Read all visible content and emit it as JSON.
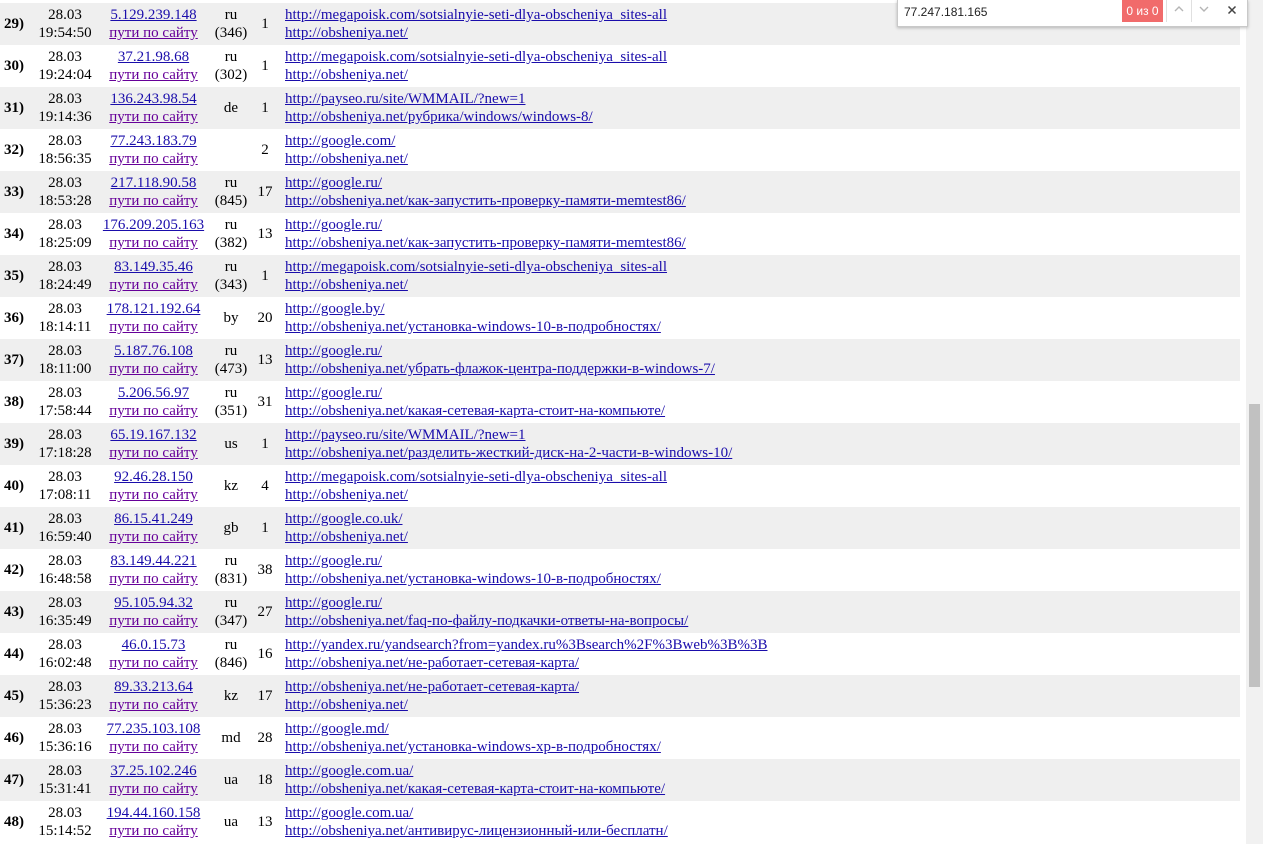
{
  "rows": [
    {
      "num": "29)",
      "date": "28.03",
      "time": "19:54:50",
      "ip": "5.129.239.148",
      "paths": "пути по сайту",
      "cc": "ru",
      "cc2": "(346)",
      "hits": "1",
      "ref1": "http://megapoisk.com/sotsialnyie-seti-dlya-obscheniya_sites-all",
      "ref2": "http://obsheniya.net/"
    },
    {
      "num": "30)",
      "date": "28.03",
      "time": "19:24:04",
      "ip": "37.21.98.68",
      "paths": "пути по сайту",
      "cc": "ru",
      "cc2": "(302)",
      "hits": "1",
      "ref1": "http://megapoisk.com/sotsialnyie-seti-dlya-obscheniya_sites-all",
      "ref2": "http://obsheniya.net/"
    },
    {
      "num": "31)",
      "date": "28.03",
      "time": "19:14:36",
      "ip": "136.243.98.54",
      "paths": "пути по сайту",
      "cc": "de",
      "cc2": "",
      "hits": "1",
      "ref1": "http://payseo.ru/site/WMMAIL/?new=1",
      "ref2": "http://obsheniya.net/рубрика/windows/windows-8/"
    },
    {
      "num": "32)",
      "date": "28.03",
      "time": "18:56:35",
      "ip": "77.243.183.79",
      "paths": "пути по сайту",
      "cc": "",
      "cc2": "",
      "hits": "2",
      "ref1": "http://google.com/",
      "ref2": "http://obsheniya.net/"
    },
    {
      "num": "33)",
      "date": "28.03",
      "time": "18:53:28",
      "ip": "217.118.90.58",
      "paths": "пути по сайту",
      "cc": "ru",
      "cc2": "(845)",
      "hits": "17",
      "ref1": "http://google.ru/",
      "ref2": "http://obsheniya.net/как-запустить-проверку-памяти-memtest86/"
    },
    {
      "num": "34)",
      "date": "28.03",
      "time": "18:25:09",
      "ip": "176.209.205.163",
      "paths": "пути по сайту",
      "cc": "ru",
      "cc2": "(382)",
      "hits": "13",
      "ref1": "http://google.ru/",
      "ref2": "http://obsheniya.net/как-запустить-проверку-памяти-memtest86/"
    },
    {
      "num": "35)",
      "date": "28.03",
      "time": "18:24:49",
      "ip": "83.149.35.46",
      "paths": "пути по сайту",
      "cc": "ru",
      "cc2": "(343)",
      "hits": "1",
      "ref1": "http://megapoisk.com/sotsialnyie-seti-dlya-obscheniya_sites-all",
      "ref2": "http://obsheniya.net/"
    },
    {
      "num": "36)",
      "date": "28.03",
      "time": "18:14:11",
      "ip": "178.121.192.64",
      "paths": "пути по сайту",
      "cc": "by",
      "cc2": "",
      "hits": "20",
      "ref1": "http://google.by/",
      "ref2": "http://obsheniya.net/установка-windows-10-в-подробностях/"
    },
    {
      "num": "37)",
      "date": "28.03",
      "time": "18:11:00",
      "ip": "5.187.76.108",
      "paths": "пути по сайту",
      "cc": "ru",
      "cc2": "(473)",
      "hits": "13",
      "ref1": "http://google.ru/",
      "ref2": "http://obsheniya.net/убрать-флажок-центра-поддержки-в-windows-7/"
    },
    {
      "num": "38)",
      "date": "28.03",
      "time": "17:58:44",
      "ip": "5.206.56.97",
      "paths": "пути по сайту",
      "cc": "ru",
      "cc2": "(351)",
      "hits": "31",
      "ref1": "http://google.ru/",
      "ref2": "http://obsheniya.net/какая-сетевая-карта-стоит-на-компьюте/"
    },
    {
      "num": "39)",
      "date": "28.03",
      "time": "17:18:28",
      "ip": "65.19.167.132",
      "paths": "пути по сайту",
      "cc": "us",
      "cc2": "",
      "hits": "1",
      "ref1": "http://payseo.ru/site/WMMAIL/?new=1",
      "ref2": "http://obsheniya.net/разделить-жесткий-диск-на-2-части-в-windows-10/"
    },
    {
      "num": "40)",
      "date": "28.03",
      "time": "17:08:11",
      "ip": "92.46.28.150",
      "paths": "пути по сайту",
      "cc": "kz",
      "cc2": "",
      "hits": "4",
      "ref1": "http://megapoisk.com/sotsialnyie-seti-dlya-obscheniya_sites-all",
      "ref2": "http://obsheniya.net/"
    },
    {
      "num": "41)",
      "date": "28.03",
      "time": "16:59:40",
      "ip": "86.15.41.249",
      "paths": "пути по сайту",
      "cc": "gb",
      "cc2": "",
      "hits": "1",
      "ref1": "http://google.co.uk/",
      "ref2": "http://obsheniya.net/"
    },
    {
      "num": "42)",
      "date": "28.03",
      "time": "16:48:58",
      "ip": "83.149.44.221",
      "paths": "пути по сайту",
      "cc": "ru",
      "cc2": "(831)",
      "hits": "38",
      "ref1": "http://google.ru/",
      "ref2": "http://obsheniya.net/установка-windows-10-в-подробностях/"
    },
    {
      "num": "43)",
      "date": "28.03",
      "time": "16:35:49",
      "ip": "95.105.94.32",
      "paths": "пути по сайту",
      "cc": "ru",
      "cc2": "(347)",
      "hits": "27",
      "ref1": "http://google.ru/",
      "ref2": "http://obsheniya.net/faq-по-файлу-подкачки-ответы-на-вопросы/"
    },
    {
      "num": "44)",
      "date": "28.03",
      "time": "16:02:48",
      "ip": "46.0.15.73",
      "paths": "пути по сайту",
      "cc": "ru",
      "cc2": "(846)",
      "hits": "16",
      "ref1": "http://yandex.ru/yandsearch?from=yandex.ru%3Bsearch%2F%3Bweb%3B%3B",
      "ref2": "http://obsheniya.net/не-работает-сетевая-карта/"
    },
    {
      "num": "45)",
      "date": "28.03",
      "time": "15:36:23",
      "ip": "89.33.213.64",
      "paths": "пути по сайту",
      "cc": "kz",
      "cc2": "",
      "hits": "17",
      "ref1": "http://obsheniya.net/не-работает-сетевая-карта/",
      "ref2": "http://obsheniya.net/"
    },
    {
      "num": "46)",
      "date": "28.03",
      "time": "15:36:16",
      "ip": "77.235.103.108",
      "paths": "пути по сайту",
      "cc": "md",
      "cc2": "",
      "hits": "28",
      "ref1": "http://google.md/",
      "ref2": "http://obsheniya.net/установка-windows-xp-в-подробностях/"
    },
    {
      "num": "47)",
      "date": "28.03",
      "time": "15:31:41",
      "ip": "37.25.102.246",
      "paths": "пути по сайту",
      "cc": "ua",
      "cc2": "",
      "hits": "18",
      "ref1": "http://google.com.ua/",
      "ref2": "http://obsheniya.net/какая-сетевая-карта-стоит-на-компьюте/"
    },
    {
      "num": "48)",
      "date": "28.03",
      "time": "15:14:52",
      "ip": "194.44.160.158",
      "paths": "пути по сайту",
      "cc": "ua",
      "cc2": "",
      "hits": "13",
      "ref1": "http://google.com.ua/",
      "ref2": "http://obsheniya.net/антивирус-лицензионный-или-бесплатн/"
    }
  ],
  "find_bar": {
    "query": "77.247.181.165",
    "count": "0 из 0",
    "prev_icon": "chevron-up-icon",
    "next_icon": "chevron-down-icon",
    "close_icon": "close-icon"
  },
  "colors": {
    "row_alt": "#efefef",
    "link": "#1a0dab",
    "find_no_match": "#f16b6b"
  }
}
